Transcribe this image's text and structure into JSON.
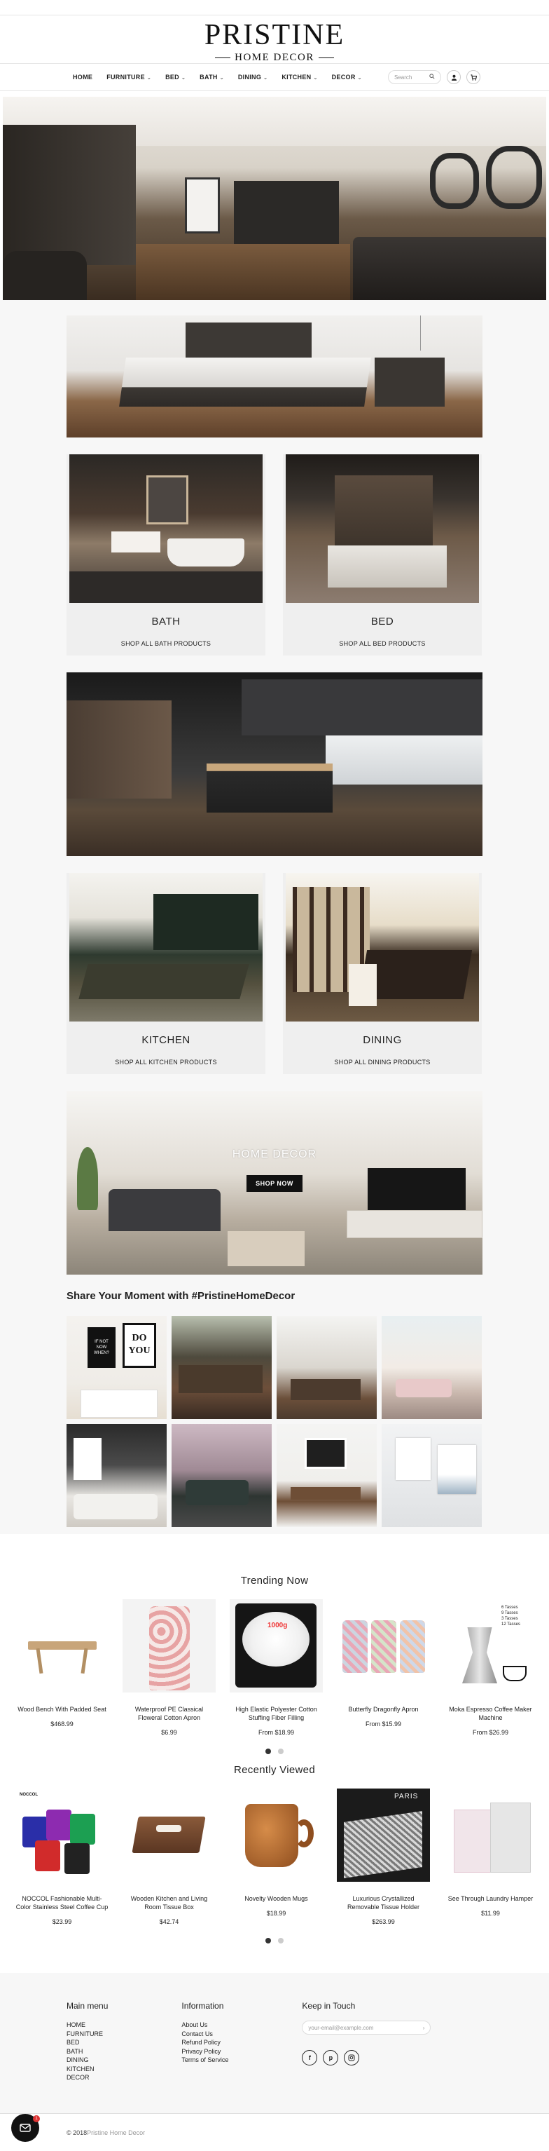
{
  "brand": {
    "name": "PRISTINE",
    "tagline": "HOME DECOR"
  },
  "nav": {
    "items": [
      {
        "label": "HOME",
        "has_dropdown": false
      },
      {
        "label": "FURNITURE",
        "has_dropdown": true
      },
      {
        "label": "BED",
        "has_dropdown": true
      },
      {
        "label": "BATH",
        "has_dropdown": true
      },
      {
        "label": "DINING",
        "has_dropdown": true
      },
      {
        "label": "KITCHEN",
        "has_dropdown": true
      },
      {
        "label": "DECOR",
        "has_dropdown": true
      }
    ],
    "search_placeholder": "Search",
    "icons": {
      "search": "search-icon",
      "account": "user-icon",
      "cart": "cart-icon"
    }
  },
  "collections": {
    "bath": {
      "title": "BATH",
      "link": "SHOP ALL BATH PRODUCTS"
    },
    "bed": {
      "title": "BED",
      "link": "SHOP ALL BED PRODUCTS"
    },
    "kitchen": {
      "title": "KITCHEN",
      "link": "SHOP ALL KITCHEN PRODUCTS"
    },
    "dining": {
      "title": "DINING",
      "link": "SHOP ALL DINING PRODUCTS"
    },
    "decor": {
      "title": "HOME DECOR",
      "button": "SHOP NOW"
    }
  },
  "instagram": {
    "title": "Share Your Moment with #PristineHomeDecor",
    "poster_a": "IF NOT NOW WHEN?",
    "poster_b": "DO YOU"
  },
  "trending": {
    "title": "Trending Now",
    "products": [
      {
        "name": "Wood Bench With Padded Seat",
        "price": "$468.99"
      },
      {
        "name": "Waterproof PE Classical Floweral Cotton Apron",
        "price": "$6.99"
      },
      {
        "name": "High Elastic Polyester Cotton Stuffing Fiber Filling",
        "price": "From $18.99",
        "image_label": "1000g"
      },
      {
        "name": "Butterfly Dragonfly Apron",
        "price": "From $15.99"
      },
      {
        "name": "Moka Espresso Coffee Maker Machine",
        "price": "From $26.99",
        "image_label": "6 Tasses\n9 Tasses\n3 Tasses\n12 Tasses"
      }
    ],
    "page_count": 2,
    "active_page": 1
  },
  "recent": {
    "title": "Recently Viewed",
    "products": [
      {
        "name": "NOCCOL Fashionable Multi-Color Stainless Steel Coffee Cup",
        "price": "$23.99",
        "image_label": "NOCCOL"
      },
      {
        "name": "Wooden Kitchen and Living Room Tissue Box",
        "price": "$42.74"
      },
      {
        "name": "Novelty Wooden Mugs",
        "price": "$18.99"
      },
      {
        "name": "Luxurious Crystallized Removable Tissue Holder",
        "price": "$263.99",
        "image_label": "PARIS"
      },
      {
        "name": "See Through Laundry Hamper",
        "price": "$11.99"
      }
    ],
    "page_count": 2,
    "active_page": 1
  },
  "footer": {
    "main_menu": {
      "title": "Main menu",
      "items": [
        "HOME",
        "FURNITURE",
        "BED",
        "BATH",
        "DINING",
        "KITCHEN",
        "DECOR"
      ]
    },
    "information": {
      "title": "Information",
      "items": [
        "About Us",
        "Contact Us",
        "Refund Policy",
        "Privacy Policy",
        "Terms of Service"
      ]
    },
    "keep_in_touch": {
      "title": "Keep in Touch",
      "email_placeholder": "your-email@example.com",
      "social": [
        "f",
        "p",
        "ig"
      ]
    },
    "copyright_prefix": "© 2018 ",
    "copyright_brand": "Pristine Home Decor",
    "chat_badge": "1"
  }
}
